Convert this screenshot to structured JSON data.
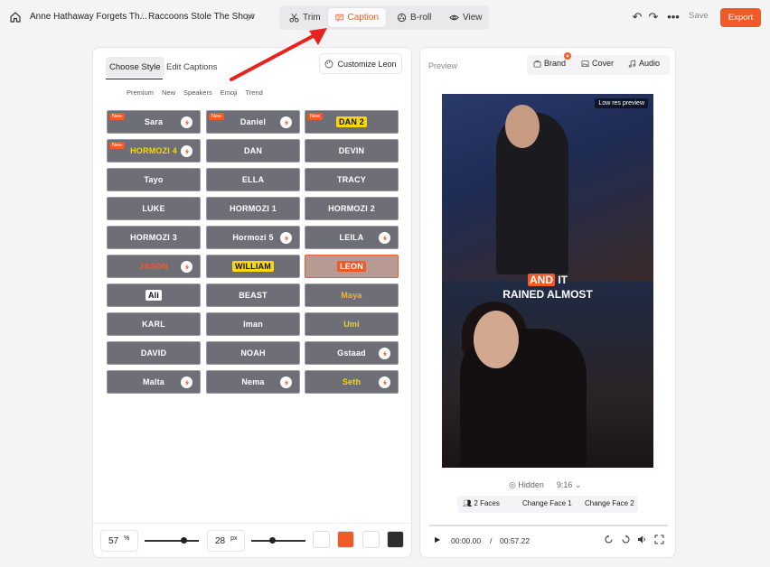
{
  "header": {
    "breadcrumb_project": "Anne Hathaway Forgets Th...",
    "breadcrumb_sep": "/",
    "breadcrumb_video": "Raccoons Stole The Show",
    "tabs": [
      {
        "label": "Trim",
        "icon": "scissors-icon"
      },
      {
        "label": "Caption",
        "icon": "caption-icon"
      },
      {
        "label": "B-roll",
        "icon": "broll-icon"
      },
      {
        "label": "View",
        "icon": "eye-icon"
      }
    ],
    "active_tab": "Caption",
    "save_label": "Save",
    "export_label": "Export"
  },
  "left_panel": {
    "tabs": [
      "Choose Style",
      "Edit Captions"
    ],
    "active_tab": "Choose Style",
    "customize_label": "Customize Leon",
    "filters": [
      "Premium",
      "New",
      "Speakers",
      "Emoji",
      "Trend"
    ],
    "styles": [
      {
        "label": "Sara",
        "new": true,
        "premium": true
      },
      {
        "label": "Daniel",
        "new": true,
        "premium": true
      },
      {
        "label": "DAN 2",
        "new": true,
        "premium": false
      },
      {
        "label": "HORMOZI 4",
        "new": true,
        "premium": true
      },
      {
        "label": "DAN",
        "new": false,
        "premium": false
      },
      {
        "label": "DEVIN",
        "new": false,
        "premium": false
      },
      {
        "label": "Tayo",
        "new": false,
        "premium": false
      },
      {
        "label": "ELLA",
        "new": false,
        "premium": false
      },
      {
        "label": "TRACY",
        "new": false,
        "premium": false
      },
      {
        "label": "LUKE",
        "new": false,
        "premium": false
      },
      {
        "label": "HORMOZI 1",
        "new": false,
        "premium": false
      },
      {
        "label": "HORMOZI 2",
        "new": false,
        "premium": false
      },
      {
        "label": "HORMOZI 3",
        "new": false,
        "premium": false
      },
      {
        "label": "Hormozi 5",
        "new": false,
        "premium": true
      },
      {
        "label": "LEILA",
        "new": false,
        "premium": true
      },
      {
        "label": "JASON",
        "new": false,
        "premium": true
      },
      {
        "label": "WILLIAM",
        "new": false,
        "premium": false
      },
      {
        "label": "LEON",
        "new": false,
        "premium": false,
        "selected": true
      },
      {
        "label": "Ali",
        "new": false,
        "premium": false
      },
      {
        "label": "BEAST",
        "new": false,
        "premium": false
      },
      {
        "label": "Maya",
        "new": false,
        "premium": false
      },
      {
        "label": "KARL",
        "new": false,
        "premium": false
      },
      {
        "label": "Iman",
        "new": false,
        "premium": false
      },
      {
        "label": "Umi",
        "new": false,
        "premium": false
      },
      {
        "label": "DAVID",
        "new": false,
        "premium": false
      },
      {
        "label": "NOAH",
        "new": false,
        "premium": false
      },
      {
        "label": "Gstaad",
        "new": false,
        "premium": true
      },
      {
        "label": "Malta",
        "new": false,
        "premium": true
      },
      {
        "label": "Nema",
        "new": false,
        "premium": true
      },
      {
        "label": "Seth",
        "new": false,
        "premium": true
      }
    ],
    "new_badge": "New",
    "bottom": {
      "position_value": "57",
      "position_unit": "%",
      "size_value": "28",
      "size_unit": "px",
      "swatches": [
        "#ffffff",
        "#f05a28",
        "#ffffff",
        "#2e2e30"
      ]
    }
  },
  "right_panel": {
    "preview_label": "Preview",
    "tabs": [
      {
        "label": "Brand",
        "icon": "briefcase-icon"
      },
      {
        "label": "Cover",
        "icon": "image-icon"
      },
      {
        "label": "Audio",
        "icon": "music-icon"
      }
    ],
    "lowres_label": "Low res preview",
    "caption_highlight": "AND",
    "caption_rest1": " IT",
    "caption_line2": "RAINED ALMOST",
    "hidden_label": "Hidden",
    "ratio_label": "9:16",
    "faces_label": "2 Faces",
    "change_face1": "Change Face 1",
    "change_face2": "Change Face 2",
    "current_time": "00:00.00",
    "time_sep": "/",
    "duration": "00:57.22"
  },
  "colors": {
    "accent": "#f05a28"
  }
}
